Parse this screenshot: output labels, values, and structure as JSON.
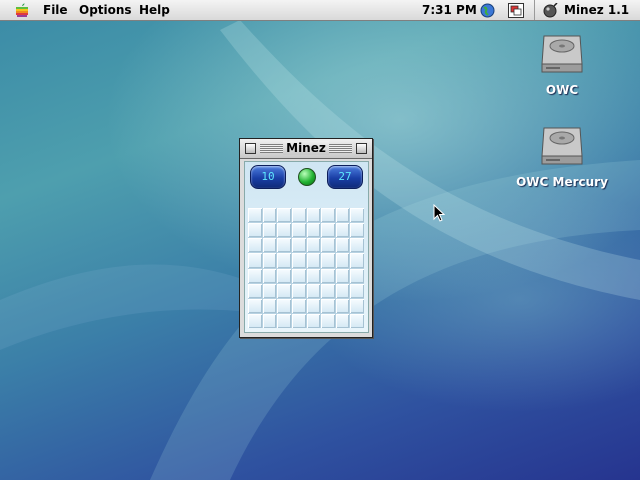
{
  "menubar": {
    "apple_icon": "apple-icon",
    "menus": [
      "File",
      "Options",
      "Help"
    ],
    "clock": "7:31 PM",
    "extra_icons": [
      "globe-icon",
      "control-strip-icon"
    ],
    "app_name": "Minez 1.1",
    "app_icon": "minez-app-icon"
  },
  "desktop": {
    "icons": [
      {
        "label": "OWC",
        "icon": "hard-disk-icon"
      },
      {
        "label": "OWC Mercury",
        "icon": "hard-disk-icon"
      }
    ]
  },
  "window": {
    "title": "Minez",
    "mines_counter": "10",
    "timer": "27",
    "face_icon": "green-smiley-button",
    "grid": {
      "rows": 8,
      "cols": 8
    }
  },
  "colors": {
    "lcd_text": "#5ee8ff",
    "lcd_bg": "#1a3fa6",
    "cell": "#e3f1f9"
  }
}
